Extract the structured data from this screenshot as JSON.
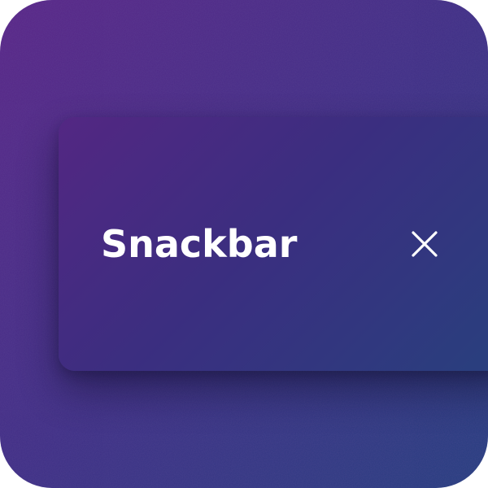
{
  "snackbar": {
    "message": "Snackbar",
    "close_icon": "close-icon"
  },
  "colors": {
    "background_start": "#5b2588",
    "background_end": "#243f7f",
    "snackbar_start": "#532783",
    "snackbar_end": "#28407e",
    "text": "#ffffff"
  }
}
